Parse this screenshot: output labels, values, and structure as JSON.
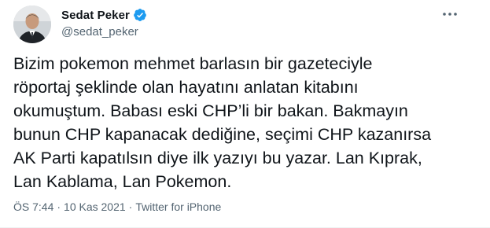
{
  "author": {
    "display_name": "Sedat Peker",
    "handle": "@sedat_peker",
    "verified_icon": "verified-badge-icon",
    "avatar_icon": "profile-photo"
  },
  "tweet": {
    "text": "Bizim pokemon mehmet barlasın bir gazeteciyle\nröportaj şeklinde olan hayatını anlatan kitabını\nokumuştum. Babası eski CHP’li bir bakan. Bakmayın\nbunun CHP kapanacak dediğine, seçimi CHP kazanırsa\nAK Parti kapatılsın diye ilk yazıyı bu yazar. Lan Kıprak,\nLan Kablama, Lan Pokemon.",
    "time": "ÖS 7:44",
    "separator": "·",
    "date": "10 Kas 2021",
    "source": "Twitter for iPhone"
  },
  "colors": {
    "text": "#0f1419",
    "secondary": "#536471",
    "verified": "#1d9bf0"
  },
  "icons": {
    "more": "more-options-icon"
  }
}
